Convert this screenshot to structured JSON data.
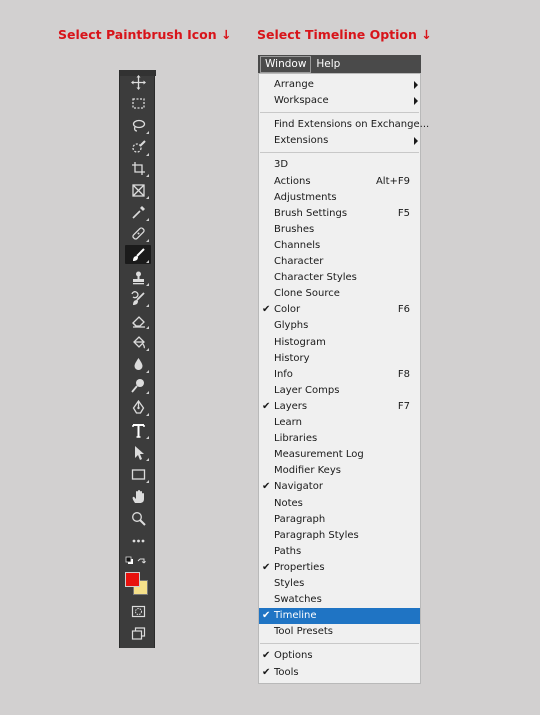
{
  "captions": {
    "left": "Select Paintbrush Icon ↓",
    "right": "Select Timeline Option ↓"
  },
  "toolbar": {
    "tools": [
      {
        "name": "move-tool",
        "icon": "move-icon"
      },
      {
        "name": "marquee-tool",
        "icon": "rectangular-marquee-icon"
      },
      {
        "name": "lasso-tool",
        "icon": "lasso-icon"
      },
      {
        "name": "quick-selection-tool",
        "icon": "quick-selection-icon"
      },
      {
        "name": "crop-tool",
        "icon": "crop-icon"
      },
      {
        "name": "frame-tool",
        "icon": "frame-icon"
      },
      {
        "name": "eyedropper-tool",
        "icon": "eyedropper-icon"
      },
      {
        "name": "healing-brush-tool",
        "icon": "bandage-icon"
      },
      {
        "name": "brush-tool",
        "icon": "paintbrush-icon",
        "active": true
      },
      {
        "name": "clone-stamp-tool",
        "icon": "stamp-icon"
      },
      {
        "name": "history-brush-tool",
        "icon": "history-brush-icon"
      },
      {
        "name": "eraser-tool",
        "icon": "eraser-icon"
      },
      {
        "name": "paint-bucket-tool",
        "icon": "paint-bucket-icon"
      },
      {
        "name": "blur-tool",
        "icon": "droplet-icon"
      },
      {
        "name": "dodge-tool",
        "icon": "dodge-icon"
      },
      {
        "name": "pen-tool",
        "icon": "pen-icon"
      },
      {
        "name": "type-tool",
        "icon": "type-icon"
      },
      {
        "name": "path-selection-tool",
        "icon": "arrow-pointer-icon"
      },
      {
        "name": "rectangle-tool",
        "icon": "rectangle-icon"
      },
      {
        "name": "hand-tool",
        "icon": "hand-icon"
      },
      {
        "name": "zoom-tool",
        "icon": "magnifier-icon"
      },
      {
        "name": "edit-toolbar",
        "icon": "more-dots-icon"
      }
    ],
    "foreground_color": "#e8120e",
    "background_color": "#f5e08a"
  },
  "menubar": {
    "items": [
      "Window",
      "Help"
    ]
  },
  "menu": {
    "groups": [
      [
        {
          "label": "Arrange",
          "submenu": true
        },
        {
          "label": "Workspace",
          "submenu": true
        }
      ],
      [
        {
          "label": "Find Extensions on Exchange..."
        },
        {
          "label": "Extensions",
          "submenu": true
        }
      ],
      [
        {
          "label": "3D"
        },
        {
          "label": "Actions",
          "shortcut": "Alt+F9"
        },
        {
          "label": "Adjustments"
        },
        {
          "label": "Brush Settings",
          "shortcut": "F5"
        },
        {
          "label": "Brushes"
        },
        {
          "label": "Channels"
        },
        {
          "label": "Character"
        },
        {
          "label": "Character Styles"
        },
        {
          "label": "Clone Source"
        },
        {
          "label": "Color",
          "shortcut": "F6",
          "checked": true
        },
        {
          "label": "Glyphs"
        },
        {
          "label": "Histogram"
        },
        {
          "label": "History"
        },
        {
          "label": "Info",
          "shortcut": "F8"
        },
        {
          "label": "Layer Comps"
        },
        {
          "label": "Layers",
          "shortcut": "F7",
          "checked": true
        },
        {
          "label": "Learn"
        },
        {
          "label": "Libraries"
        },
        {
          "label": "Measurement Log"
        },
        {
          "label": "Modifier Keys"
        },
        {
          "label": "Navigator",
          "checked": true
        },
        {
          "label": "Notes"
        },
        {
          "label": "Paragraph"
        },
        {
          "label": "Paragraph Styles"
        },
        {
          "label": "Paths"
        },
        {
          "label": "Properties",
          "checked": true
        },
        {
          "label": "Styles"
        },
        {
          "label": "Swatches"
        },
        {
          "label": "Timeline",
          "checked": true,
          "highlighted": true
        },
        {
          "label": "Tool Presets"
        }
      ],
      [
        {
          "label": "Options",
          "checked": true
        },
        {
          "label": "Tools",
          "checked": true
        }
      ]
    ],
    "highlight_color": "#1f74c4",
    "check_glyph": "✔"
  }
}
